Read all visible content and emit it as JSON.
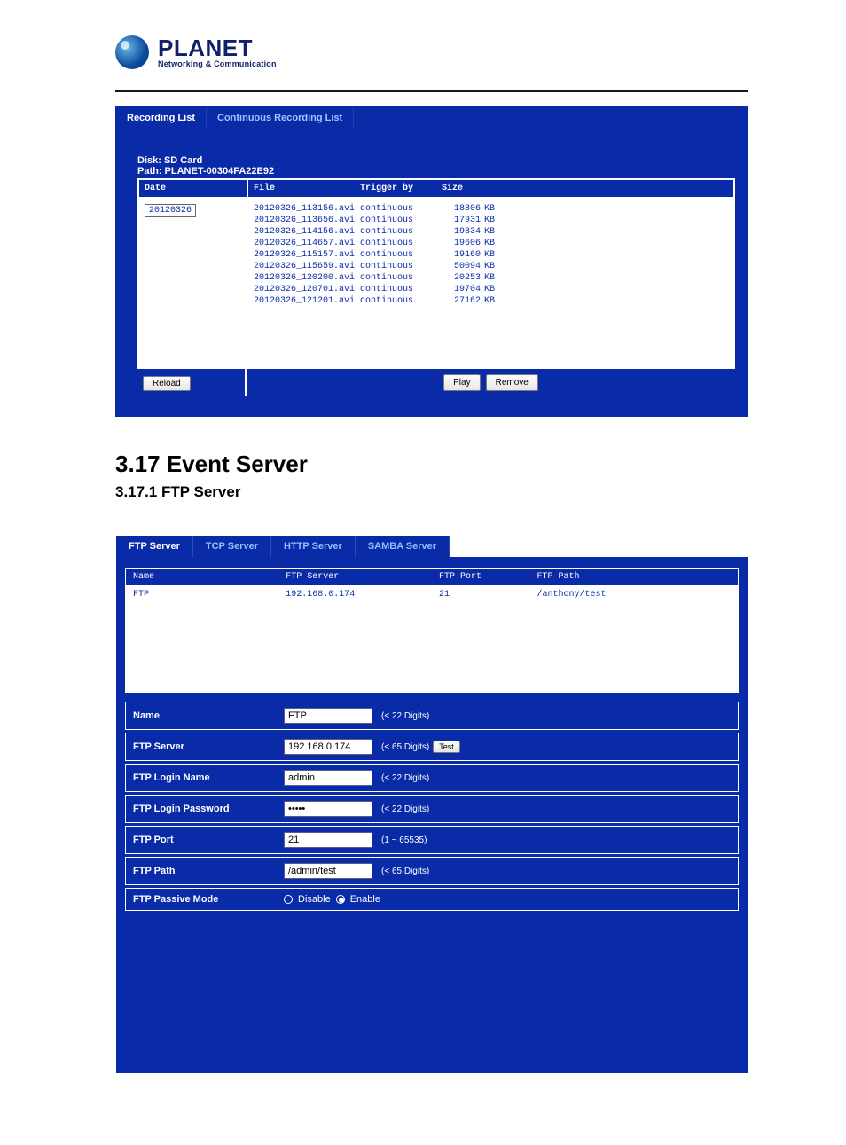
{
  "logo": {
    "main": "PLANET",
    "sub": "Networking & Communication"
  },
  "shot1": {
    "tabs": {
      "recording": "Recording List",
      "continuous": "Continuous Recording List"
    },
    "disk": "Disk: SD Card",
    "path": "Path: PLANET-00304FA22E92",
    "headers": {
      "date": "Date",
      "file": "File",
      "trigger": "Trigger by",
      "size": "Size"
    },
    "dates": [
      "20120326"
    ],
    "rows": [
      {
        "file": "20120326_113156.avi",
        "trigger": "continuous",
        "size": "18806",
        "unit": "KB"
      },
      {
        "file": "20120326_113656.avi",
        "trigger": "continuous",
        "size": "17931",
        "unit": "KB"
      },
      {
        "file": "20120326_114156.avi",
        "trigger": "continuous",
        "size": "19834",
        "unit": "KB"
      },
      {
        "file": "20120326_114657.avi",
        "trigger": "continuous",
        "size": "19606",
        "unit": "KB"
      },
      {
        "file": "20120326_115157.avi",
        "trigger": "continuous",
        "size": "19160",
        "unit": "KB"
      },
      {
        "file": "20120326_115659.avi",
        "trigger": "continuous",
        "size": "50094",
        "unit": "KB"
      },
      {
        "file": "20120326_120200.avi",
        "trigger": "continuous",
        "size": "20253",
        "unit": "KB"
      },
      {
        "file": "20120326_120701.avi",
        "trigger": "continuous",
        "size": "19704",
        "unit": "KB"
      },
      {
        "file": "20120326_121201.avi",
        "trigger": "continuous",
        "size": "27162",
        "unit": "KB"
      }
    ],
    "buttons": {
      "reload": "Reload",
      "play": "Play",
      "remove": "Remove"
    }
  },
  "headings": {
    "h2": "3.17 Event Server",
    "h3": "3.17.1 FTP Server"
  },
  "shot2": {
    "tabs": {
      "ftp": "FTP Server",
      "tcp": "TCP Server",
      "http": "HTTP Server",
      "samba": "SAMBA Server"
    },
    "table": {
      "headers": {
        "name": "Name",
        "server": "FTP Server",
        "port": "FTP Port",
        "path": "FTP Path"
      },
      "row": {
        "name": "FTP",
        "server": "192.168.0.174",
        "port": "21",
        "path": "/anthony/test"
      }
    },
    "form": {
      "name": {
        "label": "Name",
        "value": "FTP",
        "hint": "(< 22 Digits)"
      },
      "server": {
        "label": "FTP Server",
        "value": "192.168.0.174",
        "hint": "(< 65 Digits)",
        "test": "Test"
      },
      "login": {
        "label": "FTP Login Name",
        "value": "admin",
        "hint": "(< 22 Digits)"
      },
      "password": {
        "label": "FTP Login Password",
        "value": "•••••",
        "hint": "(< 22 Digits)"
      },
      "port": {
        "label": "FTP Port",
        "value": "21",
        "hint": "(1 ~ 65535)"
      },
      "path": {
        "label": "FTP Path",
        "value": "/admin/test",
        "hint": "(< 65 Digits)"
      },
      "passive": {
        "label": "FTP Passive Mode",
        "disable": "Disable",
        "enable": "Enable"
      }
    }
  }
}
